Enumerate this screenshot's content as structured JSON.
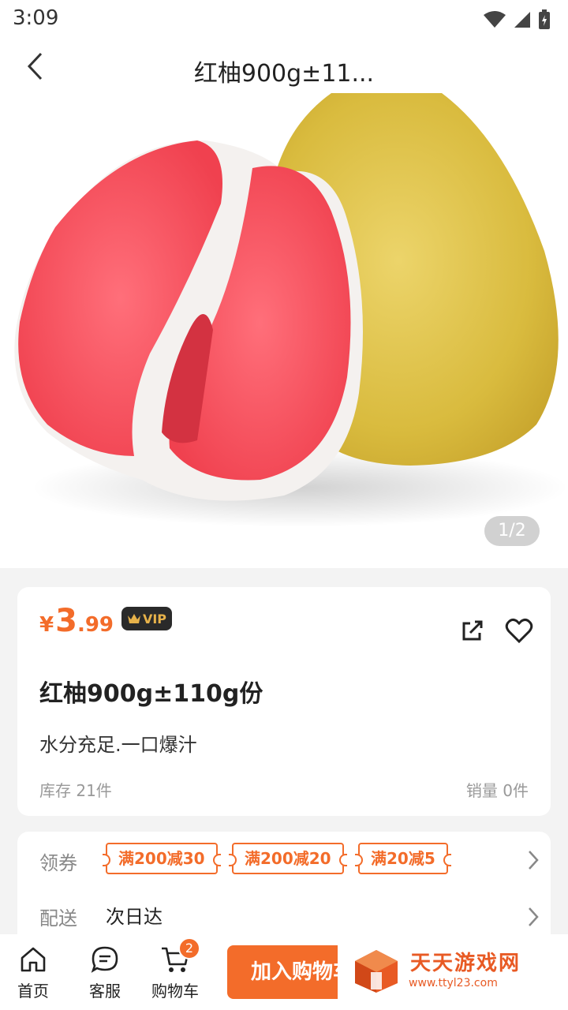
{
  "status_bar": {
    "time": "3:09"
  },
  "header": {
    "title": "红柚900g±11..."
  },
  "gallery": {
    "counter": "1/2"
  },
  "product": {
    "currency": "¥",
    "price_int": "3",
    "price_dec": ".99",
    "vip_label": "VIP",
    "name": "红柚900g±110g份",
    "description": "水分充足.一口爆汁",
    "stock": "库存 21件",
    "sales": "销量 0件"
  },
  "promo": {
    "coupon_label": "领券",
    "coupons": [
      "满200减30",
      "满200减20",
      "满20减5"
    ],
    "delivery_label": "配送",
    "delivery_value": "次日达"
  },
  "bottom_nav": {
    "home": "首页",
    "service": "客服",
    "cart": "购物车",
    "cart_count": "2",
    "add_to_cart": "加入购物车"
  },
  "watermark": {
    "name": "天天游戏网",
    "url": "www.ttyl23.com"
  },
  "colors": {
    "accent": "#f36c2a",
    "vip_bg": "#2a2a2a",
    "vip_text": "#e7b24a"
  }
}
